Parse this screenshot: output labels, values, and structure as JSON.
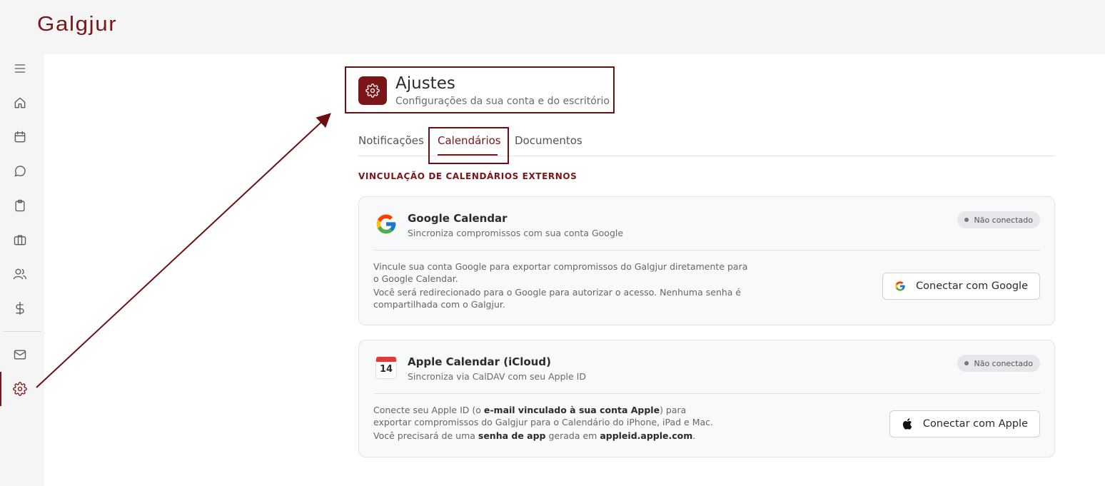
{
  "app": {
    "logo_text": "Galgjur",
    "brand_color": "#7a1518"
  },
  "sidebar": {
    "items": [
      {
        "name": "menu",
        "icon": "menu-icon"
      },
      {
        "name": "home",
        "icon": "home-icon"
      },
      {
        "name": "calendar",
        "icon": "calendar-icon"
      },
      {
        "name": "chat",
        "icon": "chat-icon"
      },
      {
        "name": "clipboard",
        "icon": "clipboard-icon"
      },
      {
        "name": "briefcase",
        "icon": "briefcase-icon"
      },
      {
        "name": "users",
        "icon": "users-icon"
      },
      {
        "name": "finance",
        "icon": "dollar-icon"
      },
      {
        "name": "mail",
        "icon": "mail-icon"
      },
      {
        "name": "settings",
        "icon": "gear-icon",
        "active": true
      }
    ]
  },
  "header": {
    "title": "Ajustes",
    "subtitle": "Configurações da sua conta e do escritório",
    "icon": "gear-icon"
  },
  "tabs": [
    {
      "label": "Notificações",
      "active": false
    },
    {
      "label": "Calendários",
      "active": true
    },
    {
      "label": "Documentos",
      "active": false
    }
  ],
  "section": {
    "title": "VINCULAÇÃO DE CALENDÁRIOS EXTERNOS"
  },
  "cards": {
    "google": {
      "icon": "google-icon",
      "title": "Google Calendar",
      "subtitle": "Sincroniza compromissos com sua conta Google",
      "status": "Não conectado",
      "desc_1": "Vincule sua conta Google para exportar compromissos do Galgjur diretamente para o Google Calendar.",
      "desc_2": "Você será redirecionado para o Google para autorizar o acesso. Nenhuma senha é compartilhada com o Galgjur.",
      "button_label": "Conectar com Google"
    },
    "apple": {
      "icon": "apple-calendar-icon",
      "calendar_day": "14",
      "title": "Apple Calendar (iCloud)",
      "subtitle": "Sincroniza via CalDAV com seu Apple ID",
      "status": "Não conectado",
      "desc_1a": "Conecte seu Apple ID (o ",
      "desc_1b": "e-mail vinculado à sua conta Apple",
      "desc_1c": ") para exportar compromissos do Galgjur para o Calendário do iPhone, iPad e Mac.",
      "desc_2a": "Você precisará de uma ",
      "desc_2b": "senha de app",
      "desc_2c": " gerada em ",
      "desc_2d": "appleid.apple.com",
      "desc_2e": ".",
      "button_label": "Conectar com Apple"
    }
  },
  "annotation": {
    "color": "#6d0f12"
  }
}
